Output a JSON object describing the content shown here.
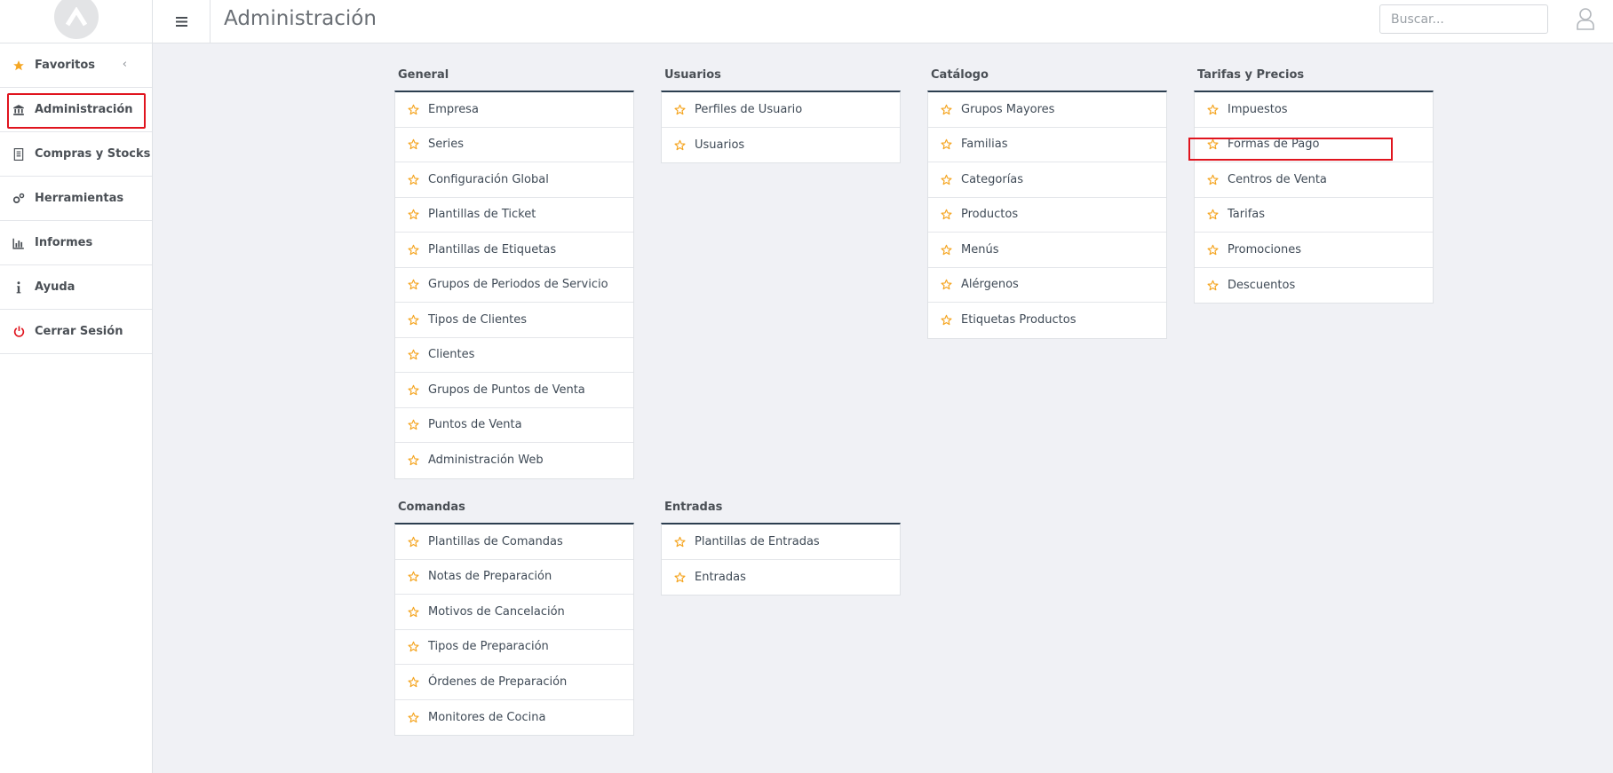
{
  "header": {
    "title": "Administración",
    "search_placeholder": "Buscar..."
  },
  "sidebar": {
    "items": [
      {
        "label": "Favoritos",
        "icon": "star-icon"
      },
      {
        "label": "Administración",
        "icon": "bank-icon"
      },
      {
        "label": "Compras y Stocks",
        "icon": "document-icon"
      },
      {
        "label": "Herramientas",
        "icon": "gears-icon"
      },
      {
        "label": "Informes",
        "icon": "bar-chart-icon"
      },
      {
        "label": "Ayuda",
        "icon": "info-icon"
      },
      {
        "label": "Cerrar Sesión",
        "icon": "power-icon"
      }
    ]
  },
  "sections": {
    "general": {
      "title": "General",
      "items": [
        "Empresa",
        "Series",
        "Configuración Global",
        "Plantillas de Ticket",
        "Plantillas de Etiquetas",
        "Grupos de Periodos de Servicio",
        "Tipos de Clientes",
        "Clientes",
        "Grupos de Puntos de Venta",
        "Puntos de Venta",
        "Administración Web"
      ]
    },
    "usuarios": {
      "title": "Usuarios",
      "items": [
        "Perfiles de Usuario",
        "Usuarios"
      ]
    },
    "catalogo": {
      "title": "Catálogo",
      "items": [
        "Grupos Mayores",
        "Familias",
        "Categorías",
        "Productos",
        "Menús",
        "Alérgenos",
        "Etiquetas Productos"
      ]
    },
    "tarifas": {
      "title": "Tarifas y Precios",
      "items": [
        "Impuestos",
        "Formas de Pago",
        "Centros de Venta",
        "Tarifas",
        "Promociones",
        "Descuentos"
      ]
    },
    "comandas": {
      "title": "Comandas",
      "items": [
        "Plantillas de Comandas",
        "Notas de Preparación",
        "Motivos de Cancelación",
        "Tipos de Preparación",
        "Órdenes de Preparación",
        "Monitores de Cocina"
      ]
    },
    "entradas": {
      "title": "Entradas",
      "items": [
        "Plantillas de Entradas",
        "Entradas"
      ]
    }
  },
  "colors": {
    "accent_star": "#f5a623",
    "card_top_border": "#2c3e50",
    "highlight": "#e0141e",
    "power_icon": "#e0141e"
  }
}
